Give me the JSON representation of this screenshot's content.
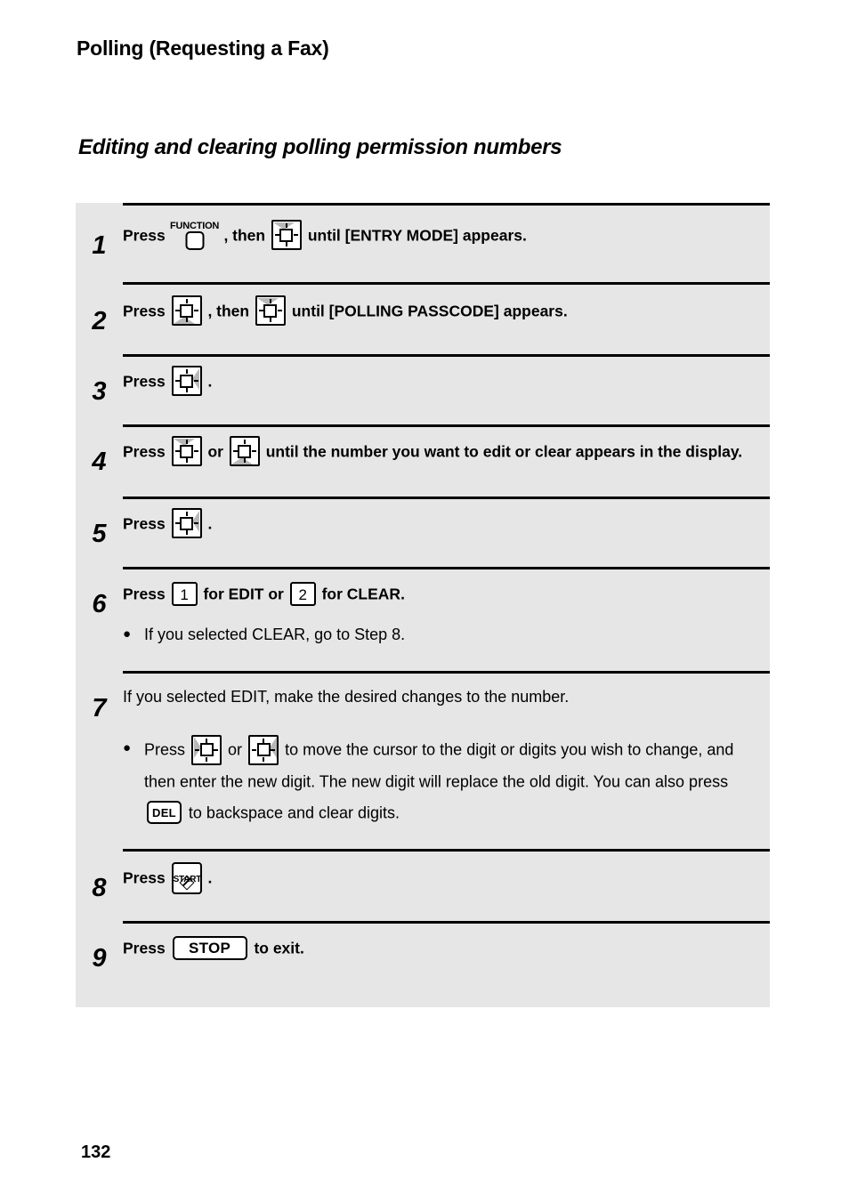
{
  "document": {
    "header_title": "Polling (Requesting a Fax)",
    "section_title": "Editing and clearing polling permission numbers",
    "page_number": "132"
  },
  "keys": {
    "function_label": "FUNCTION",
    "start_label": "START",
    "stop_label": "STOP",
    "del_label": "DEL",
    "key_1": "1",
    "key_2": "2"
  },
  "steps": [
    {
      "number": "1",
      "text_before_first_key": "Press",
      "text_between_keys": ", then",
      "text_after": "until [ENTRY MODE] appears.",
      "icon_1": "function-key-icon",
      "icon_2": "arrow-key-up-icon"
    },
    {
      "number": "2",
      "text_before_first_key": "Press",
      "text_between_keys": ", then",
      "text_after": "until [POLLING PASSCODE] appears.",
      "icon_1": "arrow-key-down-icon",
      "icon_2": "arrow-key-up-icon"
    },
    {
      "number": "3",
      "text_before_first_key": "Press",
      "text_after": ".",
      "icon_1": "arrow-key-right-icon"
    },
    {
      "number": "4",
      "text_before_first_key": "Press",
      "text_between_keys": "or",
      "text_after": "until the number you want to edit or clear appears in the display.",
      "icon_1": "arrow-key-up-icon",
      "icon_2": "arrow-key-down-icon"
    },
    {
      "number": "5",
      "text_before_first_key": "Press",
      "text_after": ".",
      "icon_1": "arrow-key-right-icon"
    },
    {
      "number": "6",
      "text_before_first_key": "Press",
      "text_mid_1": "for EDIT or",
      "text_after": "for CLEAR.",
      "bullet": "If you selected CLEAR, go to Step 8."
    },
    {
      "number": "7",
      "text_main": "If you selected EDIT, make the desired changes to the number.",
      "bullet_before": "Press",
      "bullet_between": "or",
      "bullet_after_1": "to move the cursor to the digit or digits you wish to change, and then enter the new digit. The new digit will replace the old digit. You can also press",
      "bullet_after_2": "to backspace and clear digits.",
      "icon_1": "arrow-key-left-icon",
      "icon_2": "arrow-key-right-icon"
    },
    {
      "number": "8",
      "text_before_first_key": "Press",
      "text_after": ".",
      "icon_1": "start-key-icon"
    },
    {
      "number": "9",
      "text_before_first_key": "Press",
      "text_after": "to exit.",
      "icon_1": "stop-key-icon"
    }
  ],
  "colors": {
    "panel_background": "#e6e6e6",
    "text": "#000000",
    "key_shade": "#b8b8b8",
    "page_background": "#ffffff"
  }
}
